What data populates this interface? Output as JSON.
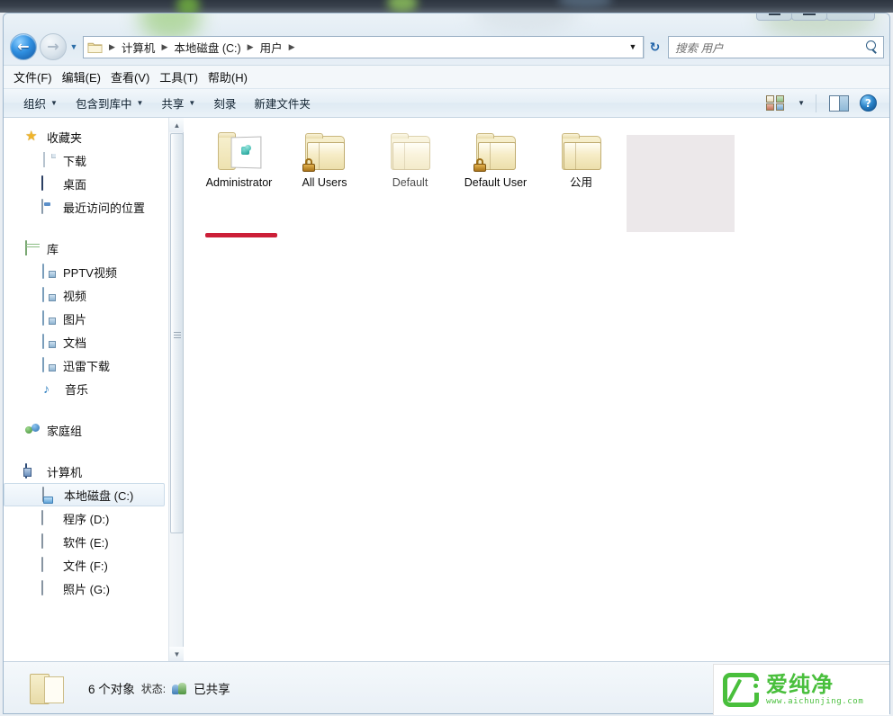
{
  "window": {
    "controls": {
      "minimize": "最小化",
      "maximize": "最大化",
      "close": "关闭"
    }
  },
  "address_bar": {
    "back_tooltip": "后退",
    "forward_tooltip": "前进",
    "history_tooltip": "最近浏览的位置",
    "refresh_tooltip": "刷新",
    "refresh_glyph": "↻",
    "breadcrumbs": [
      "计算机",
      "本地磁盘 (C:)",
      "用户"
    ],
    "separator": "▶",
    "dropdown_glyph": "▼"
  },
  "search": {
    "placeholder": "搜索 用户",
    "value": ""
  },
  "menubar": {
    "items": [
      {
        "label": "文件(F)"
      },
      {
        "label": "编辑(E)"
      },
      {
        "label": "查看(V)"
      },
      {
        "label": "工具(T)"
      },
      {
        "label": "帮助(H)"
      }
    ]
  },
  "toolbar": {
    "items": [
      {
        "label": "组织",
        "has_caret": true
      },
      {
        "label": "包含到库中",
        "has_caret": true
      },
      {
        "label": "共享",
        "has_caret": true
      },
      {
        "label": "刻录",
        "has_caret": false
      },
      {
        "label": "新建文件夹",
        "has_caret": false
      }
    ],
    "caret_glyph": "▼",
    "view_tooltip": "更改您的视图",
    "preview_tooltip": "显示预览窗格",
    "help_label": "?",
    "help_tooltip": "获取帮助"
  },
  "navigation_pane": {
    "groups": [
      {
        "header": {
          "label": "收藏夹",
          "icon": "star-icon"
        },
        "items": [
          {
            "label": "下载",
            "icon": "download-doc-icon"
          },
          {
            "label": "桌面",
            "icon": "desktop-icon"
          },
          {
            "label": "最近访问的位置",
            "icon": "recent-places-icon"
          }
        ]
      },
      {
        "header": {
          "label": "库",
          "icon": "library-icon"
        },
        "items": [
          {
            "label": "PPTV视频",
            "icon": "media-library-icon"
          },
          {
            "label": "视频",
            "icon": "media-library-icon"
          },
          {
            "label": "图片",
            "icon": "media-library-icon"
          },
          {
            "label": "文档",
            "icon": "media-library-icon"
          },
          {
            "label": "迅雷下载",
            "icon": "media-library-icon"
          },
          {
            "label": "音乐",
            "icon": "music-note-icon"
          }
        ]
      },
      {
        "header": {
          "label": "家庭组",
          "icon": "homegroup-icon"
        },
        "items": []
      },
      {
        "header": {
          "label": "计算机",
          "icon": "computer-icon"
        },
        "items": [
          {
            "label": "本地磁盘 (C:)",
            "icon": "system-drive-icon",
            "selected": true
          },
          {
            "label": "程序 (D:)",
            "icon": "drive-icon",
            "selected": false
          },
          {
            "label": "软件 (E:)",
            "icon": "drive-icon",
            "selected": false
          },
          {
            "label": "文件 (F:)",
            "icon": "drive-icon",
            "selected": false
          },
          {
            "label": "照片 (G:)",
            "icon": "drive-icon",
            "selected": false
          }
        ]
      }
    ],
    "scrollbar": {
      "up_glyph": "▲",
      "down_glyph": "▼"
    }
  },
  "file_list": {
    "items": [
      {
        "name": "Administrator",
        "icon": "open-folder-icon",
        "locked": false,
        "hidden": false,
        "annotated": true
      },
      {
        "name": "All Users",
        "icon": "folder-icon",
        "locked": true,
        "hidden": false,
        "annotated": false
      },
      {
        "name": "Default",
        "icon": "folder-icon",
        "locked": false,
        "hidden": true,
        "annotated": false
      },
      {
        "name": "Default User",
        "icon": "folder-icon",
        "locked": true,
        "hidden": false,
        "annotated": false
      },
      {
        "name": "公用",
        "icon": "folder-icon",
        "locked": false,
        "hidden": false,
        "annotated": false
      }
    ],
    "annotation_color": "#cc1f38"
  },
  "status_bar": {
    "count_text": "6 个对象",
    "state_label": "状态:",
    "share_status": "已共享",
    "folder_icon": "folder-icon",
    "share_icon": "shared-users-icon"
  },
  "watermark": {
    "brand": "爱纯净",
    "url": "www.aichunjing.com",
    "color": "#49bf3c"
  }
}
